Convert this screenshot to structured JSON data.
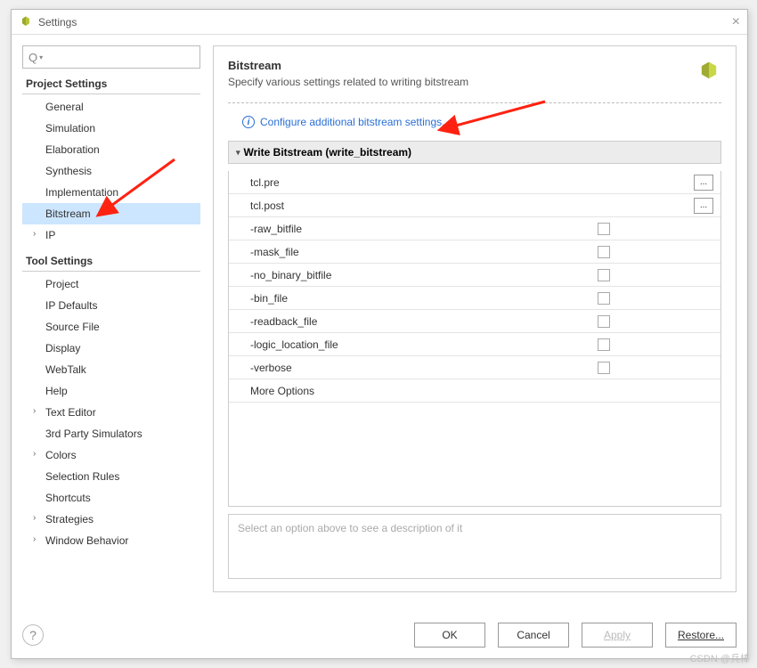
{
  "window": {
    "title": "Settings"
  },
  "search": {
    "placeholder": ""
  },
  "sidebar": {
    "groups": [
      {
        "title": "Project Settings",
        "items": [
          {
            "label": "General",
            "chev": false
          },
          {
            "label": "Simulation",
            "chev": false
          },
          {
            "label": "Elaboration",
            "chev": false
          },
          {
            "label": "Synthesis",
            "chev": false
          },
          {
            "label": "Implementation",
            "chev": false
          },
          {
            "label": "Bitstream",
            "chev": false,
            "selected": true
          },
          {
            "label": "IP",
            "chev": true
          }
        ]
      },
      {
        "title": "Tool Settings",
        "items": [
          {
            "label": "Project",
            "chev": false
          },
          {
            "label": "IP Defaults",
            "chev": false
          },
          {
            "label": "Source File",
            "chev": false
          },
          {
            "label": "Display",
            "chev": false
          },
          {
            "label": "WebTalk",
            "chev": false
          },
          {
            "label": "Help",
            "chev": false
          },
          {
            "label": "Text Editor",
            "chev": true
          },
          {
            "label": "3rd Party Simulators",
            "chev": false
          },
          {
            "label": "Colors",
            "chev": true
          },
          {
            "label": "Selection Rules",
            "chev": false
          },
          {
            "label": "Shortcuts",
            "chev": false
          },
          {
            "label": "Strategies",
            "chev": true
          },
          {
            "label": "Window Behavior",
            "chev": true
          }
        ]
      }
    ]
  },
  "main": {
    "title": "Bitstream",
    "description": "Specify various settings related to writing bitstream",
    "configure_link": "Configure additional bitstream settings.",
    "section_title": "Write Bitstream (write_bitstream)",
    "rows": [
      {
        "label": "tcl.pre",
        "type": "browse"
      },
      {
        "label": "tcl.post",
        "type": "browse"
      },
      {
        "label": "-raw_bitfile",
        "type": "check"
      },
      {
        "label": "-mask_file",
        "type": "check"
      },
      {
        "label": "-no_binary_bitfile",
        "type": "check"
      },
      {
        "label": "-bin_file",
        "type": "check"
      },
      {
        "label": "-readback_file",
        "type": "check"
      },
      {
        "label": "-logic_location_file",
        "type": "check"
      },
      {
        "label": "-verbose",
        "type": "check"
      },
      {
        "label": "More Options",
        "type": "none"
      }
    ],
    "description_box": "Select an option above to see a description of it"
  },
  "buttons": {
    "ok": "OK",
    "cancel": "Cancel",
    "apply": "Apply",
    "restore": "Restore..."
  },
  "watermark": "CSDN @兵棒"
}
